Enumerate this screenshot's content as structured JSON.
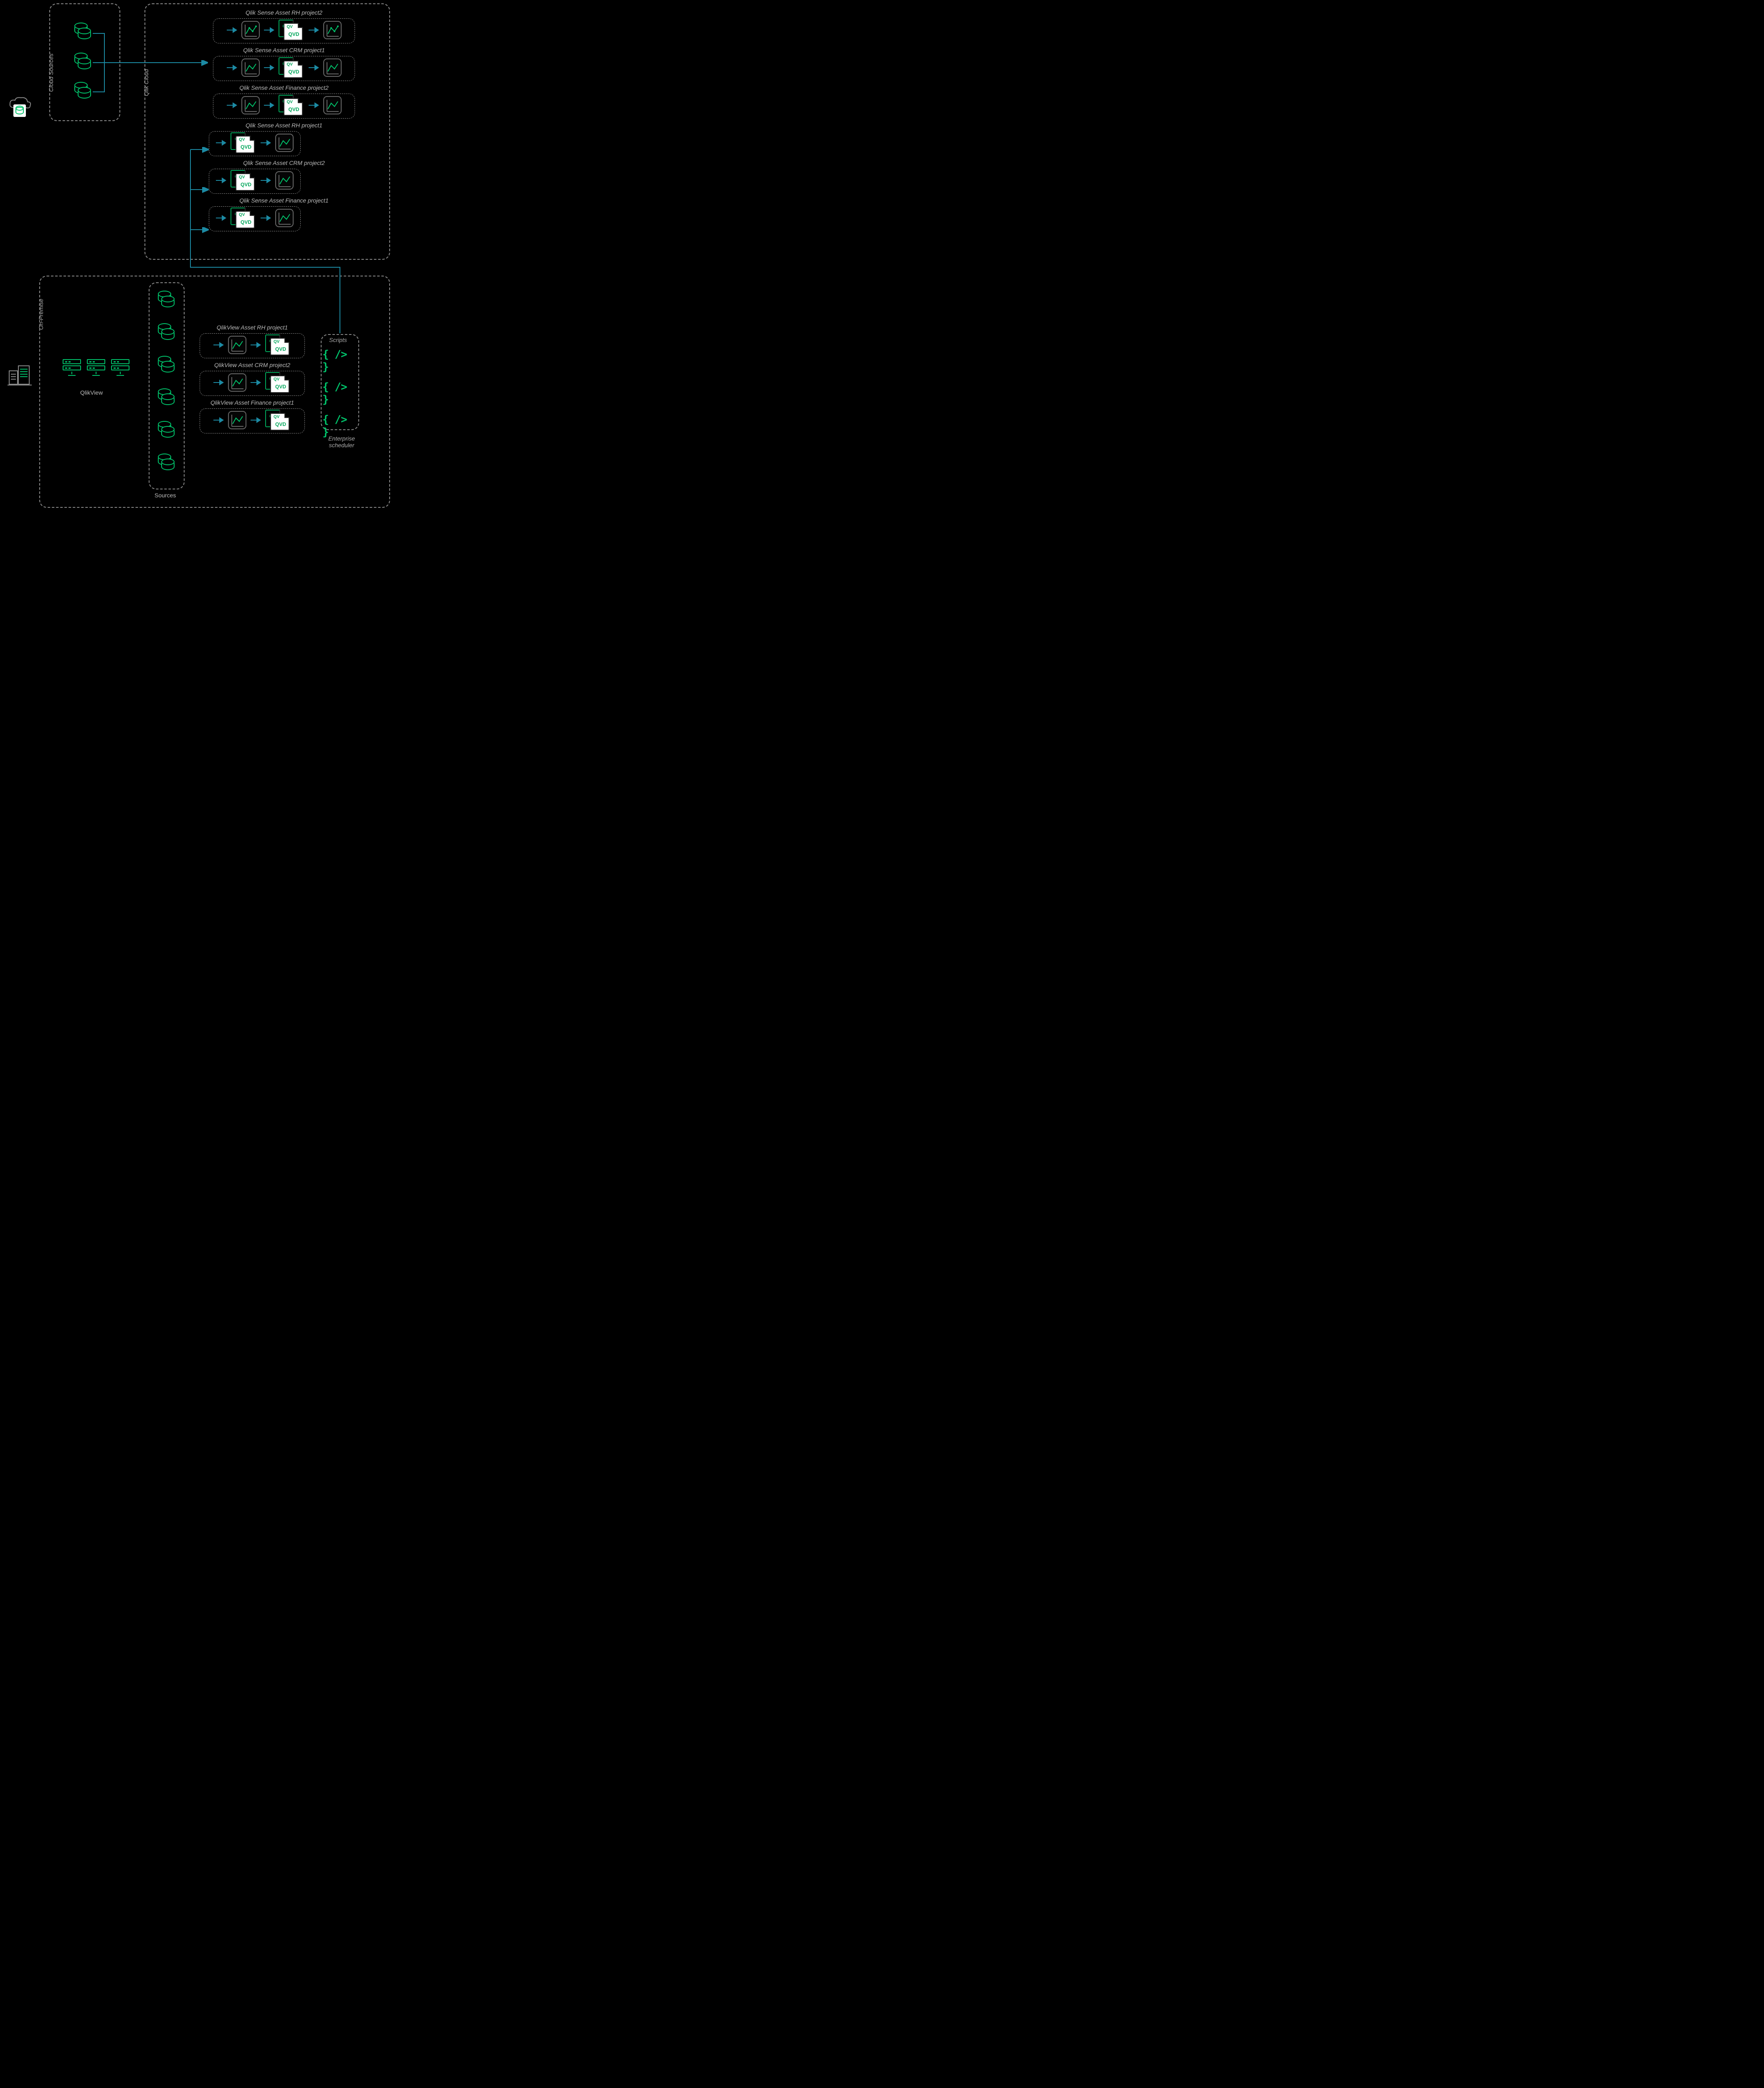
{
  "zones": {
    "cloud_sources_label": "Cloud Sources",
    "qlik_cloud_label": "Qlik Cloud",
    "on_premise_label": "On-Premise",
    "sources_label": "Sources",
    "qlikview_label": "QlikView",
    "scripts_label": "Scripts",
    "enterprise_scheduler_label": "Enterprise scheduler"
  },
  "qlik_cloud_assets": [
    {
      "title": "Qlik Sense Asset RH project2",
      "layout": "full"
    },
    {
      "title": "Qlik Sense Asset CRM project1",
      "layout": "full"
    },
    {
      "title": "Qlik Sense Asset Finance project2",
      "layout": "full"
    },
    {
      "title": "Qlik Sense Asset RH project1",
      "layout": "short"
    },
    {
      "title": "Qlik Sense Asset CRM project2",
      "layout": "short"
    },
    {
      "title": "Qlik Sense Asset Finance project1",
      "layout": "short"
    }
  ],
  "qlikview_assets": [
    {
      "title": "QlikView Asset RH project1"
    },
    {
      "title": "QlikView Asset CRM project2"
    },
    {
      "title": "QlikView Asset Finance project1"
    }
  ],
  "icons": {
    "database": "database-icon",
    "chart": "chart-icon",
    "qvd": "qvd-file-pair-icon",
    "server": "server-rack-icon",
    "script": "script-braces-icon",
    "cloud_db": "cloud-database-badge-icon",
    "building": "buildings-icon"
  },
  "counts": {
    "cloud_source_dbs": 3,
    "onprem_source_dbs": 6,
    "server_racks": 3,
    "script_items": 3
  },
  "colors": {
    "accent_green": "#00c26a",
    "wire_teal": "#1c8aa3",
    "dash_grey": "#888888",
    "text_grey": "#aaaaaa",
    "bg": "#000000"
  }
}
